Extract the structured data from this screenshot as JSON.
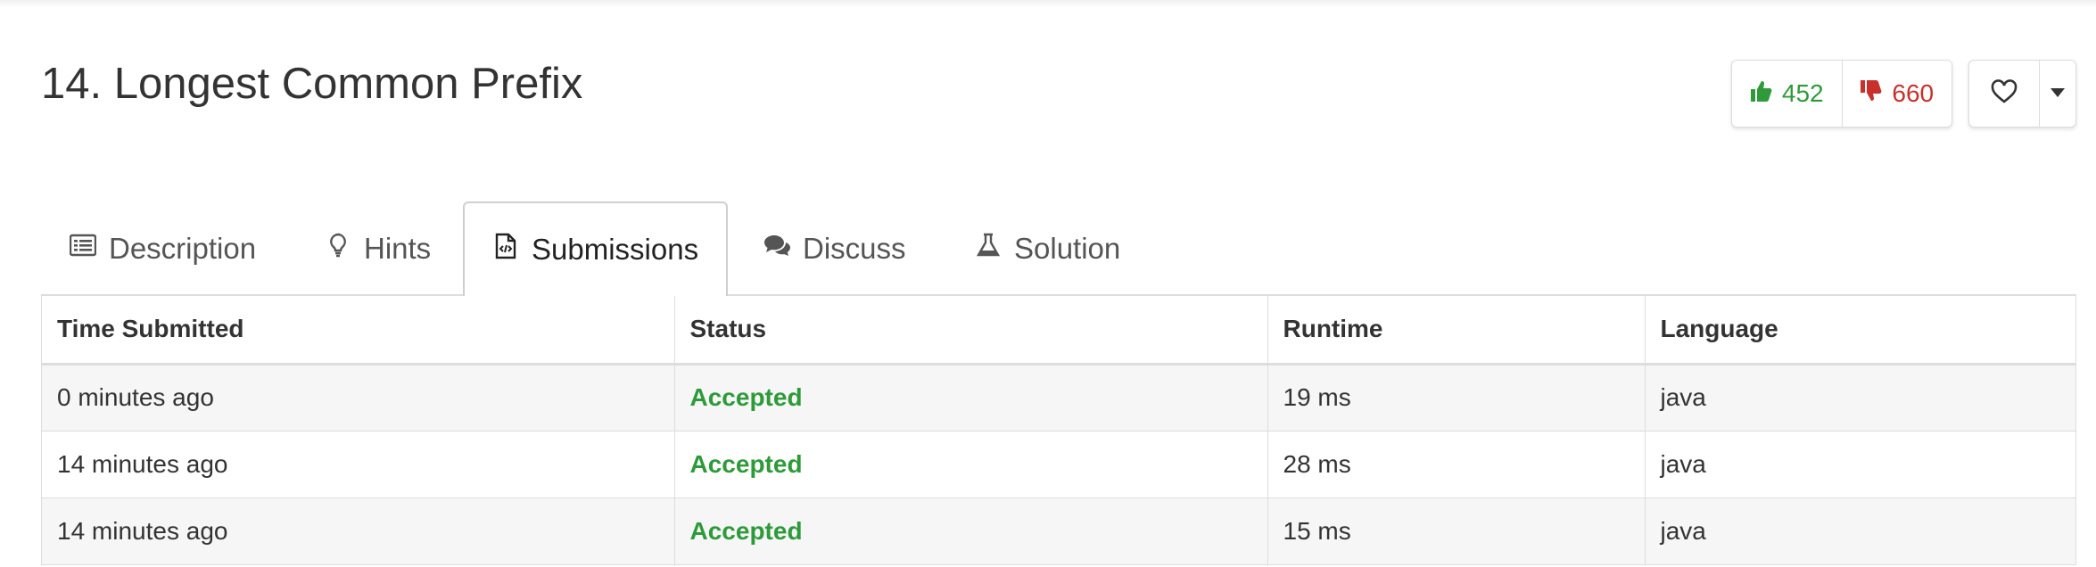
{
  "problem": {
    "title": "14. Longest Common Prefix"
  },
  "votes": {
    "likes": "452",
    "dislikes": "660",
    "like_color": "#2e9a3a",
    "dislike_color": "#c9302c"
  },
  "tabs": [
    {
      "label": "Description",
      "icon": "list-icon",
      "active": false
    },
    {
      "label": "Hints",
      "icon": "lightbulb-icon",
      "active": false
    },
    {
      "label": "Submissions",
      "icon": "code-file-icon",
      "active": true
    },
    {
      "label": "Discuss",
      "icon": "comments-icon",
      "active": false
    },
    {
      "label": "Solution",
      "icon": "flask-icon",
      "active": false
    }
  ],
  "submissions": {
    "columns": [
      "Time Submitted",
      "Status",
      "Runtime",
      "Language"
    ],
    "rows": [
      {
        "time": "0 minutes ago",
        "status": "Accepted",
        "runtime": "19 ms",
        "language": "java"
      },
      {
        "time": "14 minutes ago",
        "status": "Accepted",
        "runtime": "28 ms",
        "language": "java"
      },
      {
        "time": "14 minutes ago",
        "status": "Accepted",
        "runtime": "15 ms",
        "language": "java"
      }
    ]
  }
}
